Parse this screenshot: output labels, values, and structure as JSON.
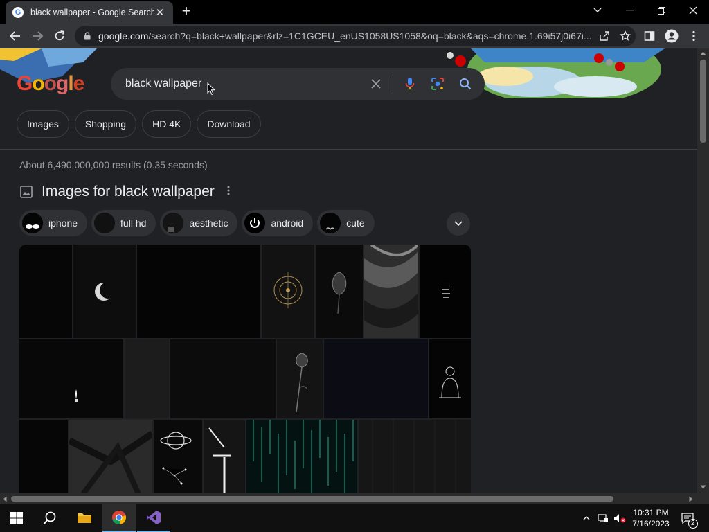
{
  "browser": {
    "tab_title": "black wallpaper - Google Search",
    "url_host": "google.com",
    "url_rest": "/search?q=black+wallpaper&rlz=1C1GCEU_enUS1058US1058&oq=black&aqs=chrome.1.69i57j0i67i..."
  },
  "search": {
    "logo_text": "Google",
    "query": "black wallpaper",
    "chips": [
      "Images",
      "Shopping",
      "HD 4K",
      "Download"
    ],
    "stats": "About 6,490,000,000 results (0.35 seconds)"
  },
  "images_section": {
    "title": "Images for black wallpaper",
    "refinements": [
      "iphone",
      "full hd",
      "aesthetic",
      "android",
      "cute"
    ]
  },
  "taskbar": {
    "time": "10:31 PM",
    "date": "7/16/2023",
    "notifications": "2"
  },
  "colors": {
    "page_bg": "#202124",
    "toolbar_bg": "#35363a",
    "chip_border": "#3c4043",
    "mic_blue": "#4285f4",
    "search_icon": "#8ab4f8"
  }
}
